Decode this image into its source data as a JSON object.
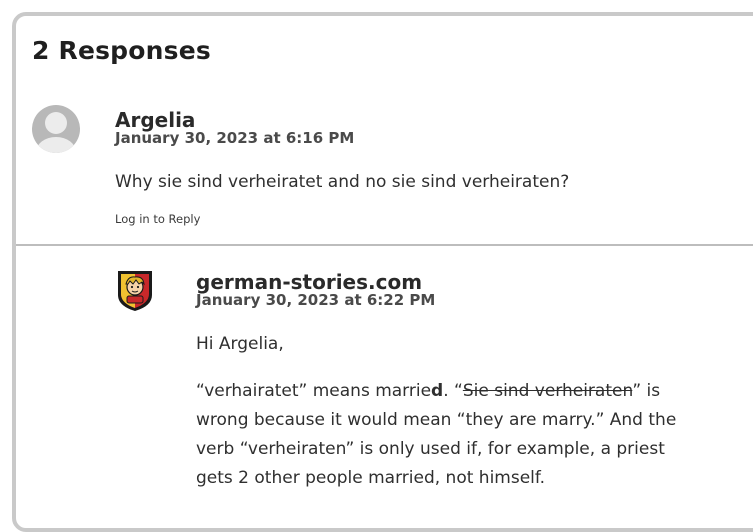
{
  "section": {
    "title": "2 Responses"
  },
  "comments": [
    {
      "author": "Argelia",
      "date": "January 30, 2023 at 6:16 PM",
      "text": "Why sie sind verheiratet and no sie sind verheiraten?",
      "reply_label": "Log in to Reply",
      "avatar": "default-user-avatar-icon"
    },
    {
      "author": "german-stories.com",
      "date": "January 30, 2023 at 6:22 PM",
      "greeting": "Hi Argelia,",
      "avatar": "comic-character-badge-icon",
      "p2": {
        "q1": "“verhairatet” means marrie",
        "bold": "d",
        "q2": ". “",
        "strike": "Sie sind verheiraten",
        "q3": "” is"
      },
      "lines": [
        "wrong because it would mean “they are marry.” And the",
        "verb “verheiraten” is only used if, for example, a priest",
        "gets 2 other people married, not himself."
      ]
    }
  ]
}
